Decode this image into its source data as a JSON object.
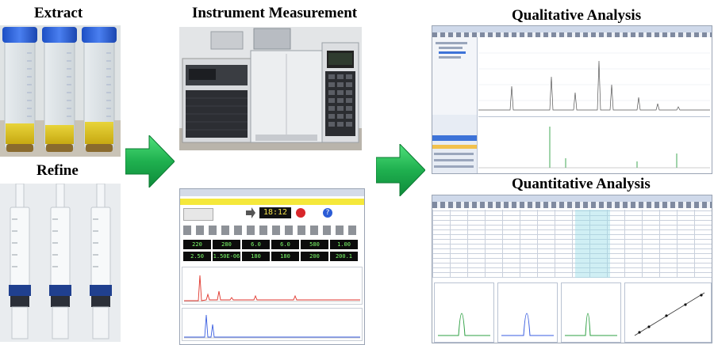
{
  "labels": {
    "extract": "Extract",
    "refine": "Refine",
    "instrument": "Instrument Measurement",
    "qualitative": "Qualitative Analysis",
    "quantitative": "Quantitative Analysis"
  },
  "instrument_readouts": [
    "220",
    "280",
    "6.0",
    "6.0",
    "580",
    "1.00",
    "2.50",
    "1.50E-06",
    "180",
    "180",
    "200",
    "200.1"
  ],
  "instrument_timer": "18:12",
  "colors": {
    "arrow_green": "#19a34a",
    "arrow_green_light": "#3fd46a",
    "tube_liquid": "#d9c21b",
    "cap_blue": "#2a5fd6",
    "plunger_blue": "#2047a8",
    "chrom_red": "#e0362c",
    "chrom_blue": "#3a5ee0",
    "chrom_green": "#2ea043",
    "chrom_gray": "#6b6b6b"
  },
  "icons": [
    "right-arrow-icon",
    "stop-icon",
    "help-icon"
  ]
}
